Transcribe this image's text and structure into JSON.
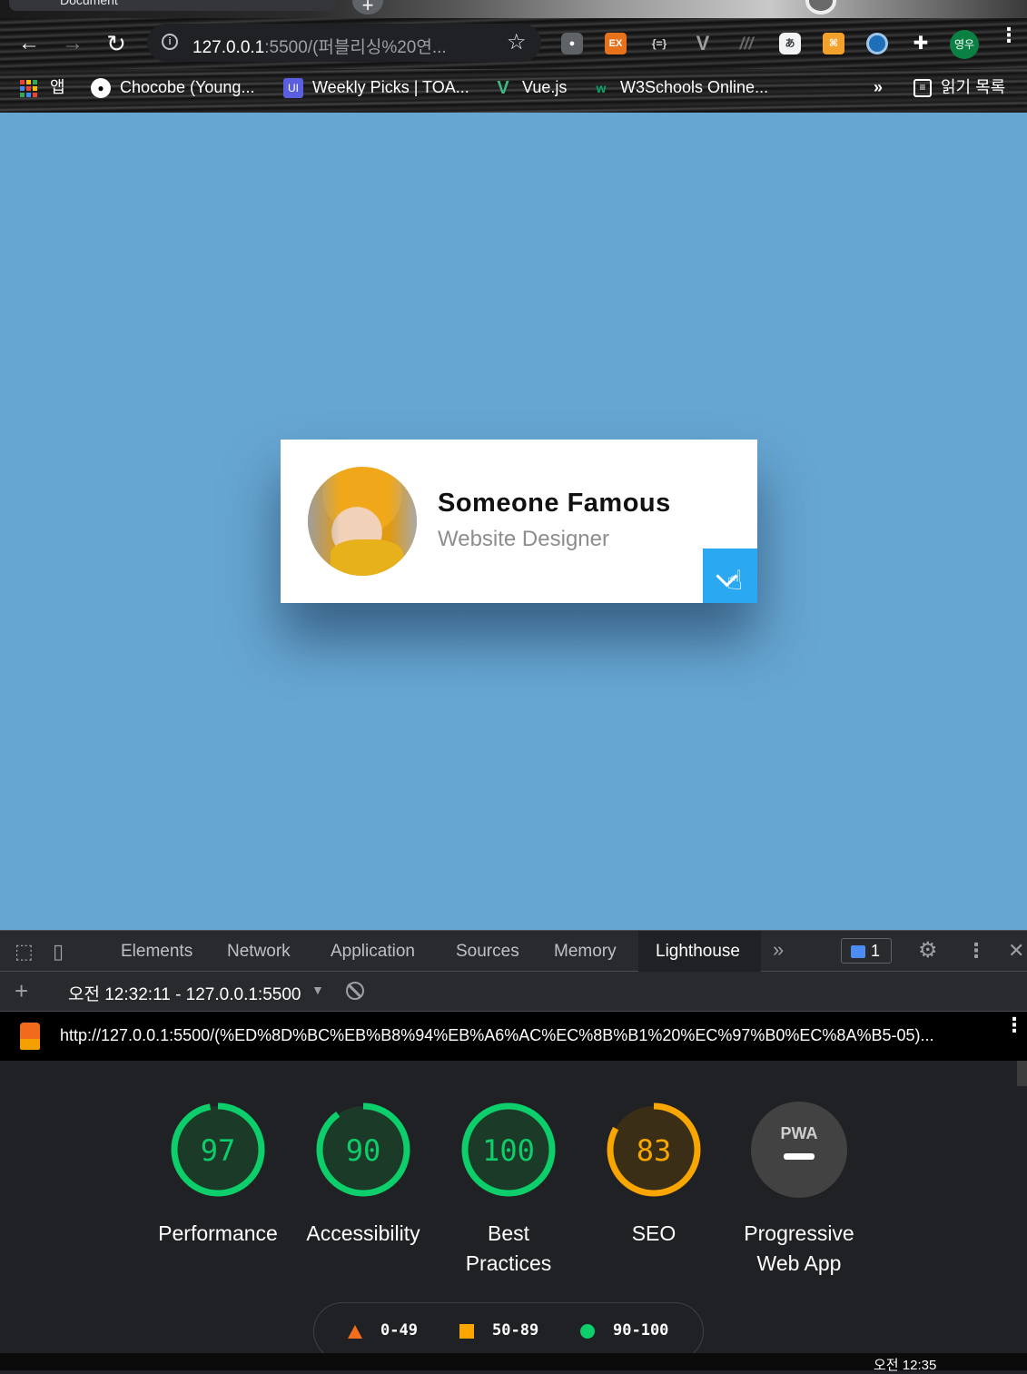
{
  "browser": {
    "tab_title": "Document",
    "new_tab_glyph": "+",
    "back_glyph": "←",
    "forward_glyph": "→",
    "reload_glyph": "↻",
    "info_glyph": "i",
    "url_host": "127.0.0.1",
    "url_rest": ":5500/(퍼블리싱%20연...",
    "star_glyph": "☆",
    "profile_label": "영우",
    "menu_glyph": "⋮",
    "extensions": [
      "camera-icon",
      "ex-icon",
      "braces-icon",
      "vue-devtools-icon",
      "ghost-icon",
      "translate-icon",
      "sitemap-icon",
      "ring-icon",
      "puzzle-icon"
    ],
    "ex_label": "EX",
    "braces_label": "{=}",
    "bookmarks": {
      "apps": "앱",
      "items": [
        "Chocobe (Young...",
        "Weekly Picks | TOA...",
        "Vue.js",
        "W3Schools Online..."
      ],
      "overflow": "»",
      "reading_list": "읽기 목록"
    }
  },
  "card": {
    "name": "Someone Famous",
    "role": "Website Designer",
    "accent": "#2aa8f2"
  },
  "devtools": {
    "tabs": [
      "Elements",
      "Network",
      "Application",
      "Sources",
      "Memory",
      "Lighthouse"
    ],
    "active_tab": "Lighthouse",
    "more_tabs_glyph": "»",
    "message_count": "1",
    "gear_glyph": "⚙",
    "menu_glyph": "⋮",
    "close_glyph": "✕",
    "add_glyph": "+",
    "report_label": "오전 12:32:11 - 127.0.0.1:5500",
    "caret_glyph": "▼",
    "lighthouse_url": "http://127.0.0.1:5500/(%ED%8D%BC%EB%B8%94%EB%A6%AC%EC%8B%B1%20%EC%97%B0%EC%8A%B5-05)...",
    "url_menu_glyph": "⋮",
    "scores": [
      {
        "label_line1": "Performance",
        "label_line2": "",
        "score": "97",
        "value": 97,
        "color": "#0ccf6b"
      },
      {
        "label_line1": "Accessibility",
        "label_line2": "",
        "score": "90",
        "value": 90,
        "color": "#0ccf6b"
      },
      {
        "label_line1": "Best",
        "label_line2": "Practices",
        "score": "100",
        "value": 100,
        "color": "#0ccf6b"
      },
      {
        "label_line1": "SEO",
        "label_line2": "",
        "score": "83",
        "value": 83,
        "color": "#f9a600"
      },
      {
        "label_line1": "Progressive",
        "label_line2": "Web App",
        "score": "PWA",
        "value": null,
        "color": "#424242"
      }
    ],
    "legend": [
      "0-49",
      "50-89",
      "90-100"
    ],
    "legend_colors": {
      "fail": "#f36e1a",
      "average": "#f9a600",
      "pass": "#0ccf6b"
    }
  },
  "taskbar": {
    "clock": "오전 12:35"
  }
}
